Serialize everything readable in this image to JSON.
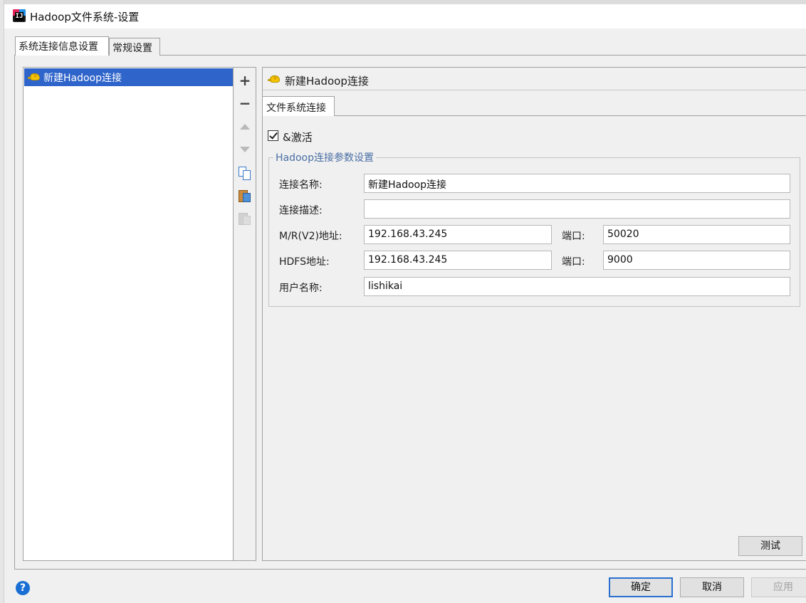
{
  "window": {
    "title": "Hadoop文件系统-设置"
  },
  "tabs": {
    "connection_settings": "系统连接信息设置",
    "general_settings": "常规设置"
  },
  "connection_list": {
    "items": [
      {
        "label": "新建Hadoop连接",
        "icon": "hadoop-elephant-icon",
        "selected": true
      }
    ]
  },
  "toolbar": {
    "add": "+",
    "remove": "−",
    "move_up_icon": "triangle-up-icon",
    "move_down_icon": "triangle-down-icon",
    "copy_icon": "copy-icon",
    "paste_icon": "paste-icon",
    "paste_disabled_icon": "paste-disabled-icon"
  },
  "detail": {
    "header_title": "新建Hadoop连接",
    "inner_tab": "文件系统连接",
    "activate_label": "&激活",
    "activate_checked": true,
    "group_title": "Hadoop连接参数设置",
    "fields": {
      "name_label": "连接名称:",
      "name_value": "新建Hadoop连接",
      "desc_label": "连接描述:",
      "desc_value": "",
      "mr_label": "M/R(V2)地址:",
      "mr_value": "192.168.43.245",
      "mr_port_label": "端口:",
      "mr_port_value": "50020",
      "hdfs_label": "HDFS地址:",
      "hdfs_value": "192.168.43.245",
      "hdfs_port_label": "端口:",
      "hdfs_port_value": "9000",
      "user_label": "用户名称:",
      "user_value": "lishikai"
    },
    "test_button": "测试"
  },
  "footer": {
    "help": "?",
    "ok": "确定",
    "cancel": "取消",
    "apply": "应用"
  },
  "colors": {
    "selection": "#2f65ca",
    "group_title": "#4a6fa5",
    "default_button_border": "#2a6fd0"
  }
}
